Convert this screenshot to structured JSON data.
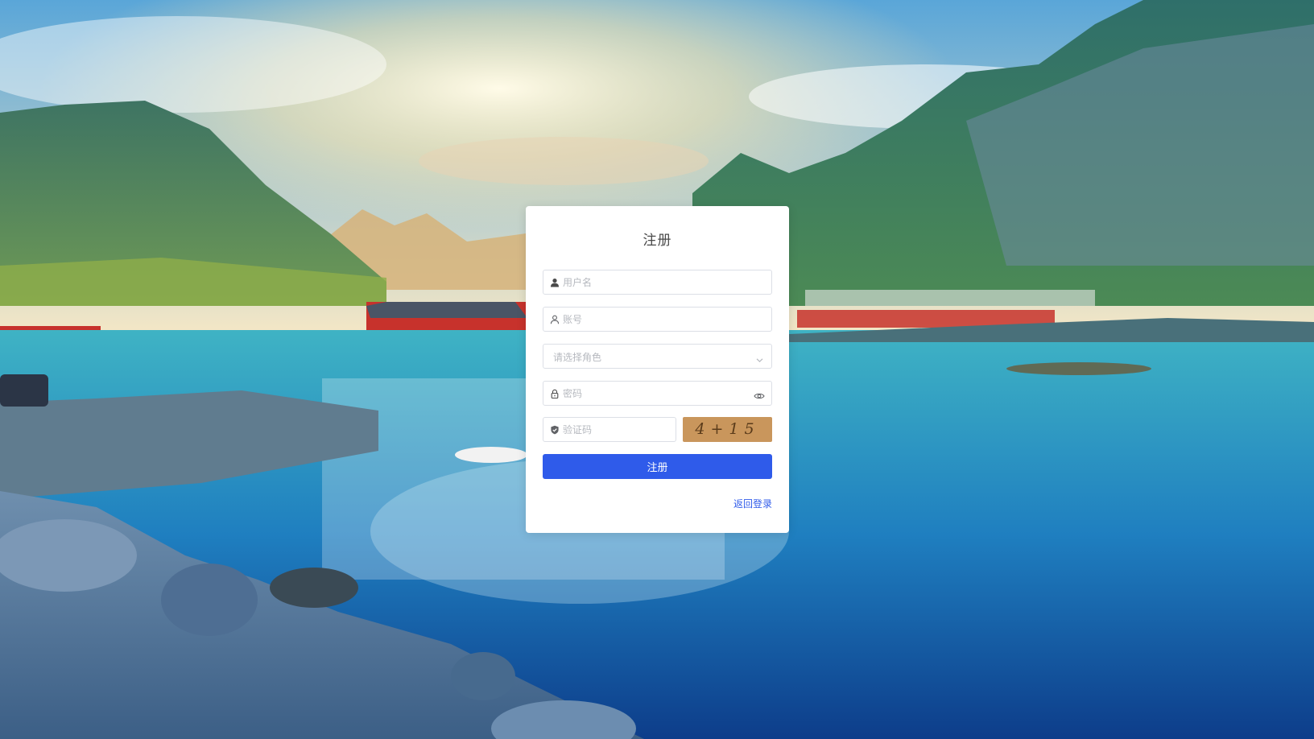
{
  "form": {
    "title": "注册",
    "username_placeholder": "用户名",
    "account_placeholder": "账号",
    "role_placeholder": "请选择角色",
    "password_placeholder": "密码",
    "captcha_placeholder": "验证码",
    "captcha_text": "4+15",
    "submit_label": "注册",
    "back_link": "返回登录"
  },
  "icons": {
    "username": "user-icon",
    "account": "user-outline-icon",
    "role": "chevron-down-icon",
    "password": "lock-icon",
    "password_toggle": "eye-icon",
    "captcha": "shield-icon"
  },
  "colors": {
    "primary": "#2f5bea",
    "captcha_bg": "#c9965c",
    "card_bg": "#ffffff"
  }
}
